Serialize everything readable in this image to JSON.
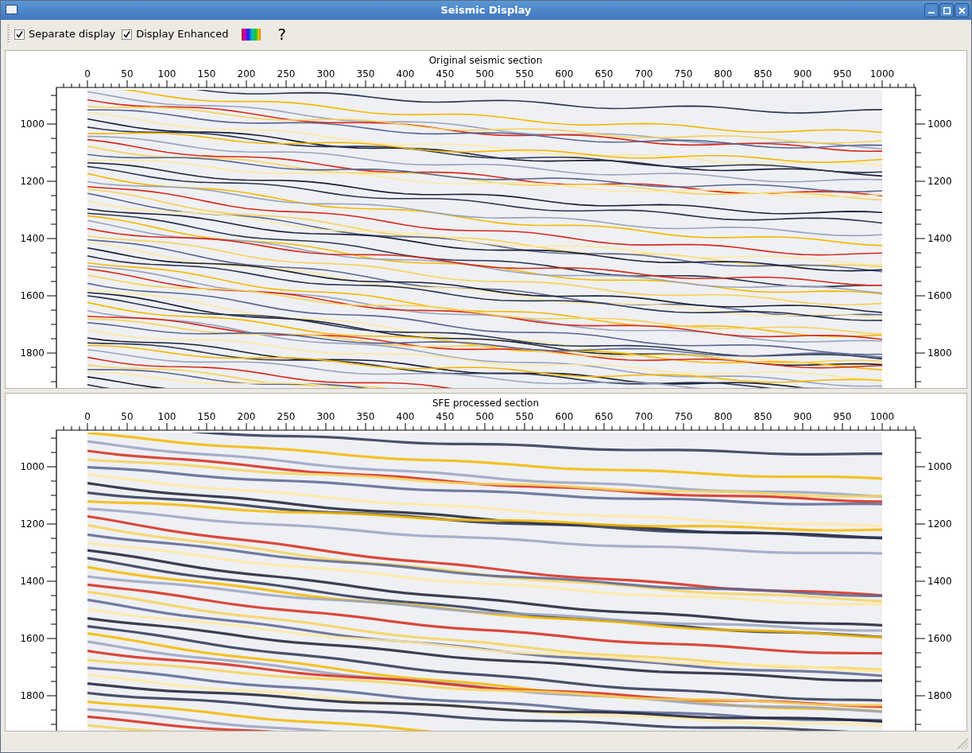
{
  "window": {
    "title": "Seismic Display"
  },
  "toolbar": {
    "checkboxes": [
      {
        "label": "Separate display",
        "checked": true
      },
      {
        "label": "Display Enhanced",
        "checked": true
      }
    ],
    "help": "?"
  },
  "panels": [
    {
      "title": "Original seismic section",
      "kind": "raw",
      "x_axis_labels": [
        "0",
        "50",
        "100",
        "150",
        "200",
        "250",
        "300",
        "350",
        "400",
        "450",
        "500",
        "550",
        "600",
        "650",
        "700",
        "750",
        "800",
        "850",
        "900",
        "950",
        "1000"
      ],
      "y_axis_left_labels": [
        "1000",
        "1200",
        "1400",
        "1600",
        "1800"
      ],
      "y_axis_right_labels": [
        "1000",
        "1200",
        "1400",
        "1600",
        "1800"
      ]
    },
    {
      "title": "SFE processed section",
      "kind": "smooth",
      "x_axis_labels": [
        "0",
        "50",
        "100",
        "150",
        "200",
        "250",
        "300",
        "350",
        "400",
        "450",
        "500",
        "550",
        "600",
        "650",
        "700",
        "750",
        "800",
        "850",
        "900",
        "950",
        "1000"
      ],
      "y_axis_left_labels": [
        "1000",
        "1200",
        "1400",
        "1600",
        "1800"
      ],
      "y_axis_right_labels": [
        "1000",
        "1200",
        "1400",
        "1600",
        "1800"
      ]
    }
  ]
}
